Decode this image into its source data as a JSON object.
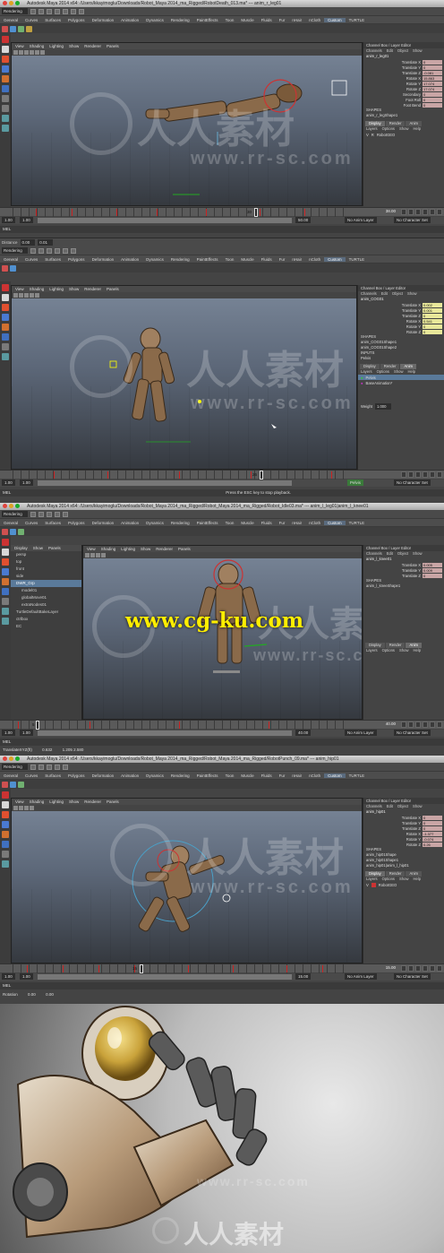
{
  "brand_colors": {
    "accent_red": "#cc2222",
    "selection_blue": "#5a7a9a",
    "keyable_yellow": "#e8e79a",
    "watermark_yellow": "#ffee00"
  },
  "shots": [
    {
      "title": "Autodesk Maya 2014 x64: /Users/kkayimoglu/Downloads/Robot_Maya 2014_ma_Rigged/RobotDeath_013.ma*  ---  anim_r_leg01",
      "mode": "Rendering",
      "object": "anim_r_leg01",
      "shape": "anim_r_legShape1",
      "shapes_label": "SHAPES",
      "inputs_label": "",
      "inputs": [],
      "attrs": [
        {
          "name": "Translate X",
          "value": "0"
        },
        {
          "name": "Translate Y",
          "value": "0"
        },
        {
          "name": "Translate Z",
          "value": "-0.081"
        },
        {
          "name": "Rotate X",
          "value": "15.863"
        },
        {
          "name": "Rotate Y",
          "value": "17.074"
        },
        {
          "name": "Rotate Z",
          "value": "17.074"
        },
        {
          "name": "Secondary",
          "value": "0"
        },
        {
          "name": "Foot Roll",
          "value": "0"
        },
        {
          "name": "Foot Bend",
          "value": "0"
        }
      ],
      "layer": "RobotGEO",
      "range_start": "1.00",
      "range_start2": "1.00",
      "range_end": "38.00",
      "range_end2": "50.00",
      "current_frame": "30",
      "anim_layer": "No Anim Layer",
      "char_set": "No Character Set",
      "cmd_label": "MEL",
      "status": "",
      "field_a_label": "",
      "field_a": "",
      "field_b": ""
    },
    {
      "title": "",
      "mode": "Rendering",
      "object": "anim_COG01",
      "shape": "anim_COG01Shape1",
      "shapes_label": "SHAPES",
      "inputs_label": "INPUTS",
      "inputs": [
        "anim_COG01Shape2"
      ],
      "attrs": [
        {
          "name": "Translate X",
          "value": "0.002"
        },
        {
          "name": "Translate Y",
          "value": "0.001"
        },
        {
          "name": "Translate Z",
          "value": "0"
        },
        {
          "name": "Rotate X",
          "value": "0.541"
        },
        {
          "name": "Rotate Y",
          "value": "0"
        },
        {
          "name": "Rotate Z",
          "value": "0"
        }
      ],
      "layer": "Pelvis",
      "layer2": "BaseAnimation*",
      "weight_label": "Weight",
      "weight": "1.000",
      "range_start": "1.00",
      "range_start2": "1.00",
      "range_end": "",
      "range_end2": "",
      "current_frame": "26",
      "anim_layer": "Pelvis",
      "char_set": "No Character Set",
      "cmd_label": "MEL",
      "status": "Press the ESC key to stop playback.",
      "field_a_label": "Distance",
      "field_a": "0.00",
      "field_b": "0.01"
    },
    {
      "title": "Autodesk Maya 2014 x64: /Users/kkayimoglu/Downloads/Robot_Maya 2014_ma_Rigged/Robot_Maya 2014_ma_Rigged/Robot_Idle03.ma*  ---  anim_l_leg01|anim_l_knee01",
      "mode": "Rendering",
      "object": "anim_l_knee01",
      "shape": "anim_l_kneeShape1",
      "shapes_label": "SHAPES",
      "inputs_label": "",
      "inputs": [],
      "attrs": [
        {
          "name": "Translate X",
          "value": "0.005"
        },
        {
          "name": "Translate Y",
          "value": "0.009"
        },
        {
          "name": "Translate Z",
          "value": "0"
        }
      ],
      "layer": "",
      "range_start": "1.00",
      "range_start2": "1.00",
      "range_end": "40.00",
      "range_end2": "40.00",
      "current_frame": "5",
      "anim_layer": "No Anim Layer",
      "char_set": "No Character Set",
      "cmd_label": "MEL",
      "status": "",
      "field_a_label": "TranslateXYZ(ft)",
      "field_a": "0.632",
      "field_b": "1.205  2.580",
      "outliner_menu": [
        "Display",
        "Show",
        "Panels"
      ],
      "outliner": [
        "persp",
        "top",
        "front",
        "side",
        "DWR_Grp",
        "model01",
        "globalMove01",
        "extraNodes01",
        "TurtleDefaultBakeLayer",
        "ctrlbox",
        "EC"
      ]
    },
    {
      "title": "Autodesk Maya 2014 x64: /Users/kkayimoglu/Downloads/Robot_Maya 2014_ma_Rigged/Robot_Maya 2014_ma_Rigged/RobotPunch_09.ma*  ---  anim_hip01",
      "mode": "Rendering",
      "object": "anim_hip01",
      "shape": "anim_hip01Shape",
      "shapes_label": "SHAPES",
      "inputs_label": "",
      "inputs": [
        "anim_hip01Shape1",
        "anim_hip01|anim_l_hip01"
      ],
      "attrs": [
        {
          "name": "Translate X",
          "value": "0"
        },
        {
          "name": "Translate Y",
          "value": "0"
        },
        {
          "name": "Translate Z",
          "value": "0"
        },
        {
          "name": "Rotate X",
          "value": "-1.377"
        },
        {
          "name": "Rotate Y",
          "value": "-0.074"
        },
        {
          "name": "Rotate Z",
          "value": "0.26"
        }
      ],
      "layer": "RobotGEO",
      "range_start": "1.00",
      "range_start2": "1.00",
      "range_end": "15.00",
      "range_end2": "15.00",
      "current_frame": "15",
      "anim_layer": "No Anim Layer",
      "char_set": "No Character Set",
      "cmd_label": "MEL",
      "status": "",
      "field_a_label": "Rotation",
      "field_a": "0.00",
      "field_b": "0.00"
    }
  ],
  "shelf_tabs": [
    "General",
    "Curves",
    "Surfaces",
    "Polygons",
    "Deformation",
    "Animation",
    "Dynamics",
    "Rendering",
    "PaintEffects",
    "Toon",
    "Muscle",
    "Fluids",
    "Fur",
    "nHair",
    "nCloth",
    "Custom",
    "TURTLE"
  ],
  "vp_menu": [
    "View",
    "Shading",
    "Lighting",
    "Show",
    "Renderer",
    "Panels"
  ],
  "cb_menu": [
    "Channels",
    "Edit",
    "Object",
    "Show"
  ],
  "cb_title": "Channel Box / Layer Editor",
  "layer_tabs": [
    "Display",
    "Render",
    "Anim"
  ],
  "layer_menu": [
    "Layers",
    "Options",
    "Show",
    "Help"
  ],
  "watermark_cn": "人人素材",
  "watermark_url": "www.rr-sc.com",
  "cgku_url": "www.cg-ku.com"
}
